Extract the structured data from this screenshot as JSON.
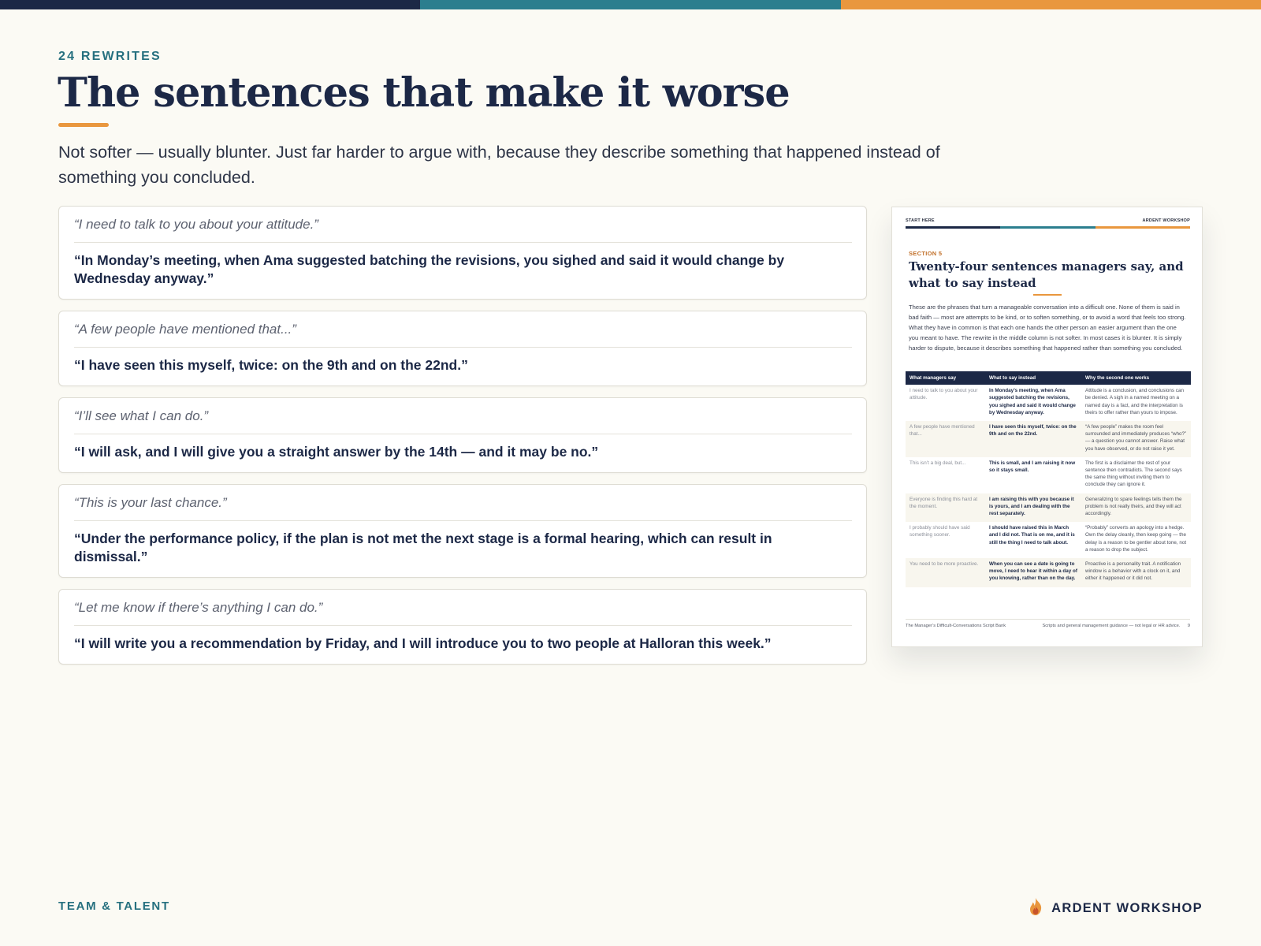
{
  "colors": {
    "navy": "#1c2846",
    "teal": "#2c7e8e",
    "orange": "#e9973e",
    "background": "#fbfaf4"
  },
  "header": {
    "eyebrow": "24 REWRITES",
    "title": "The sentences that make it worse",
    "subtitle": "Not softer — usually blunter. Just far harder to argue with, because they describe something that happened instead of something you concluded."
  },
  "rewrites": [
    {
      "say": "“I need to talk to you about your attitude.”",
      "instead": "“In Monday’s meeting, when Ama suggested batching the revisions, you sighed and said it would change by Wednesday anyway.”"
    },
    {
      "say": "“A few people have mentioned that...”",
      "instead": "“I have seen this myself, twice: on the 9th and on the 22nd.”"
    },
    {
      "say": "“I’ll see what I can do.”",
      "instead": "“I will ask, and I will give you a straight answer by the 14th — and it may be no.”"
    },
    {
      "say": "“This is your last chance.”",
      "instead": "“Under the performance policy, if the plan is not met the next stage is a formal hearing, which can result in dismissal.”"
    },
    {
      "say": "“Let me know if there’s anything I can do.”",
      "instead": "“I will write you a recommendation by Friday, and I will introduce you to two people at Halloran this week.”"
    }
  ],
  "document": {
    "header_left": "START HERE",
    "header_right": "ARDENT WORKSHOP",
    "section": "SECTION 5",
    "title": "Twenty-four sentences managers say, and what to say instead",
    "body": "These are the phrases that turn a manageable conversation into a difficult one. None of them is said in bad faith — most are attempts to be kind, or to soften something, or to avoid a word that feels too strong. What they have in common is that each one hands the other person an easier argument than the one you meant to have. The rewrite in the middle column is not softer. In most cases it is blunter. It is simply harder to dispute, because it describes something that happened rather than something you concluded.",
    "table_headers": [
      "What managers say",
      "What to say instead",
      "Why the second one works"
    ],
    "rows": [
      {
        "say": "I need to talk to you about your attitude.",
        "instead": "In Monday’s meeting, when Ama suggested batching the revisions, you sighed and said it would change by Wednesday anyway.",
        "why": "Attitude is a conclusion, and conclusions can be denied. A sigh in a named meeting on a named day is a fact, and the interpretation is theirs to offer rather than yours to impose."
      },
      {
        "say": "A few people have mentioned that...",
        "instead": "I have seen this myself, twice: on the 9th and on the 22nd.",
        "why": "“A few people” makes the room feel surrounded and immediately produces “who?” — a question you cannot answer. Raise what you have observed, or do not raise it yet."
      },
      {
        "say": "This isn’t a big deal, but...",
        "instead": "This is small, and I am raising it now so it stays small.",
        "why": "The first is a disclaimer the rest of your sentence then contradicts. The second says the same thing without inviting them to conclude they can ignore it."
      },
      {
        "say": "Everyone is finding this hard at the moment.",
        "instead": "I am raising this with you because it is yours, and I am dealing with the rest separately.",
        "why": "Generalizing to spare feelings tells them the problem is not really theirs, and they will act accordingly."
      },
      {
        "say": "I probably should have said something sooner.",
        "instead": "I should have raised this in March and I did not. That is on me, and it is still the thing I need to talk about.",
        "why": "“Probably” converts an apology into a hedge. Own the delay cleanly, then keep going — the delay is a reason to be gentler about tone, not a reason to drop the subject."
      },
      {
        "say": "You need to be more proactive.",
        "instead": "When you can see a date is going to move, I need to hear it within a day of you knowing, rather than on the day.",
        "why": "Proactive is a personality trait. A notification window is a behavior with a clock on it, and either it happened or it did not."
      }
    ],
    "footer_left": "The Manager’s Difficult-Conversations Script Bank",
    "footer_right": "Scripts and general management guidance — not legal or HR advice.",
    "page_number": "9"
  },
  "footer": {
    "left": "TEAM & TALENT",
    "brand": "ARDENT WORKSHOP",
    "brand_icon": "flame-icon"
  }
}
